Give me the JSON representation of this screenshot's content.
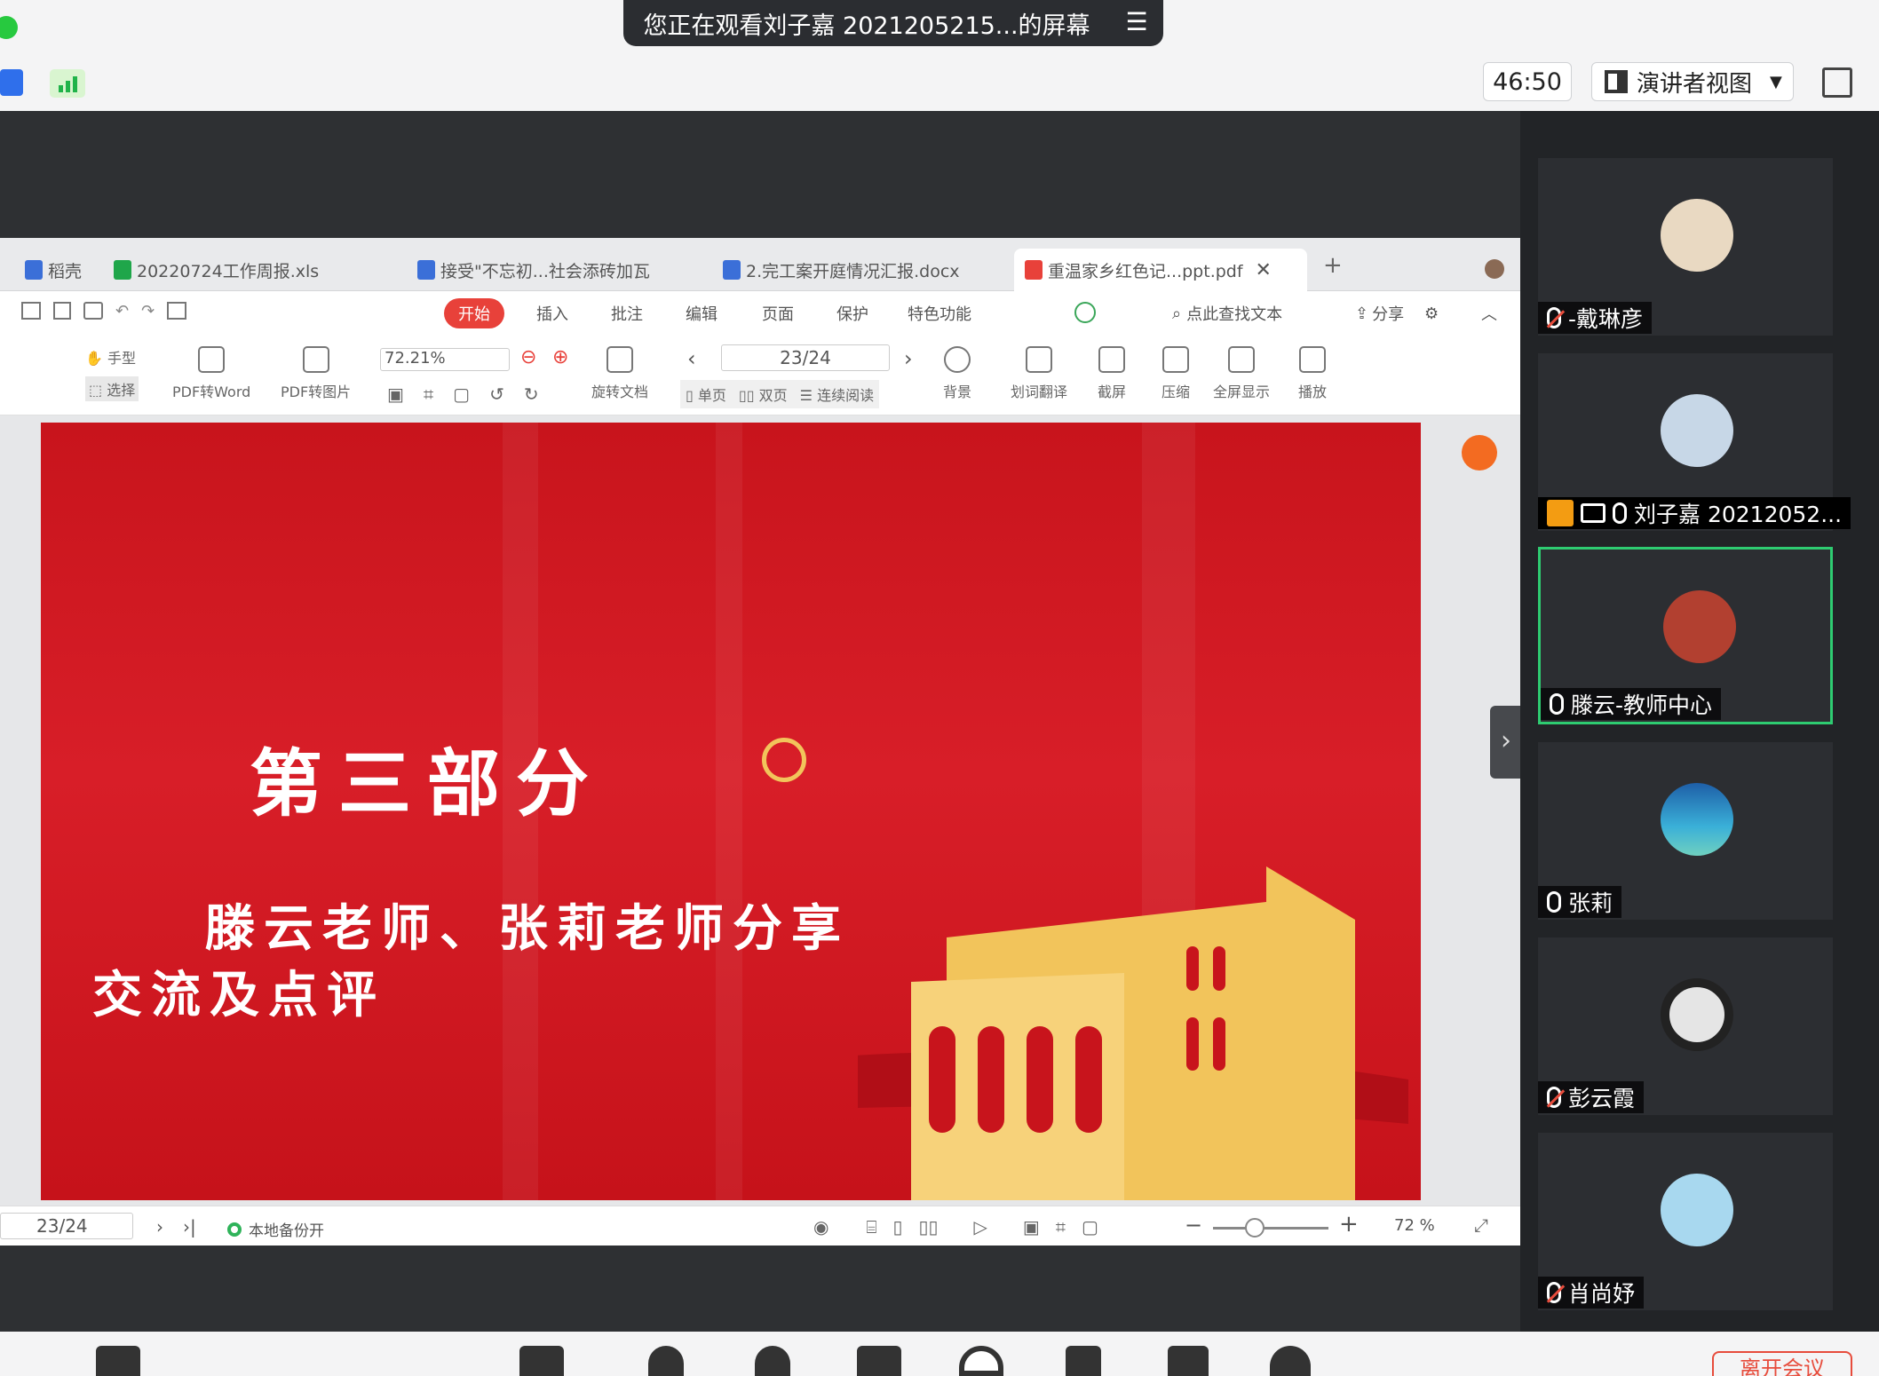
{
  "meeting": {
    "banner_text": "您正在观看刘子嘉 2021205215...的屏幕",
    "menu_icon": "hamburger-icon",
    "timer": "46:50",
    "view_mode": "演讲者视图",
    "leave_label": "离开会议"
  },
  "wps": {
    "tabs": [
      {
        "label": "稻壳",
        "icon": "docer-icon",
        "color": "#3b6fd8"
      },
      {
        "label": "20220724工作周报.xls",
        "icon": "sheet-icon",
        "color": "#1fa64a"
      },
      {
        "label": "接受\"不忘初...社会添砖加瓦",
        "icon": "word-icon",
        "color": "#3b6fd8"
      },
      {
        "label": "2.完工案开庭情况汇报.docx",
        "icon": "word-icon",
        "color": "#3b6fd8"
      },
      {
        "label": "重温家乡红色记...ppt.pdf",
        "icon": "pdf-icon",
        "color": "#e8413a"
      }
    ],
    "menus": [
      "开始",
      "插入",
      "批注",
      "编辑",
      "页面",
      "保护",
      "特色功能"
    ],
    "search_placeholder": "点此查找文本",
    "share_label": "分享",
    "tools": {
      "hand": "手型",
      "select": "选择",
      "pdf_to_word": "PDF转Word",
      "pdf_to_image": "PDF转图片",
      "rotate": "旋转文档",
      "single_page": "单页",
      "double_page": "双页",
      "continuous": "连续阅读",
      "background": "背景",
      "translate": "划词翻译",
      "screenshot": "截屏",
      "compress": "压缩",
      "fullscreen": "全屏显示",
      "play": "播放"
    },
    "zoom_value": "72.21%",
    "page_indicator": "23/24",
    "status": {
      "page": "23/24",
      "backup": "本地备份开",
      "zoom": "72 %"
    }
  },
  "slide": {
    "title": "第三部分",
    "subtitle_line1": "滕云老师、张莉老师分享",
    "subtitle_line2": "交流及点评",
    "accent": "#f2c45b",
    "background": "#d81e28"
  },
  "participants": [
    {
      "name": "-戴琳彦",
      "muted": true,
      "avatar_color": "#e9d9c2"
    },
    {
      "name": "刘子嘉 20212052...",
      "muted": false,
      "host": true,
      "sharing": true,
      "avatar_color": "#c7d7e7"
    },
    {
      "name": "滕云-教师中心",
      "muted": false,
      "active": true,
      "avatar_color": "#b24030"
    },
    {
      "name": "张莉",
      "muted": false,
      "avatar_color": "#3ab0d8"
    },
    {
      "name": "彭云霞",
      "muted": true,
      "avatar_color": "#e5e5e5"
    },
    {
      "name": "肖尚妤",
      "muted": true,
      "avatar_color": "#a8d8ef"
    }
  ]
}
